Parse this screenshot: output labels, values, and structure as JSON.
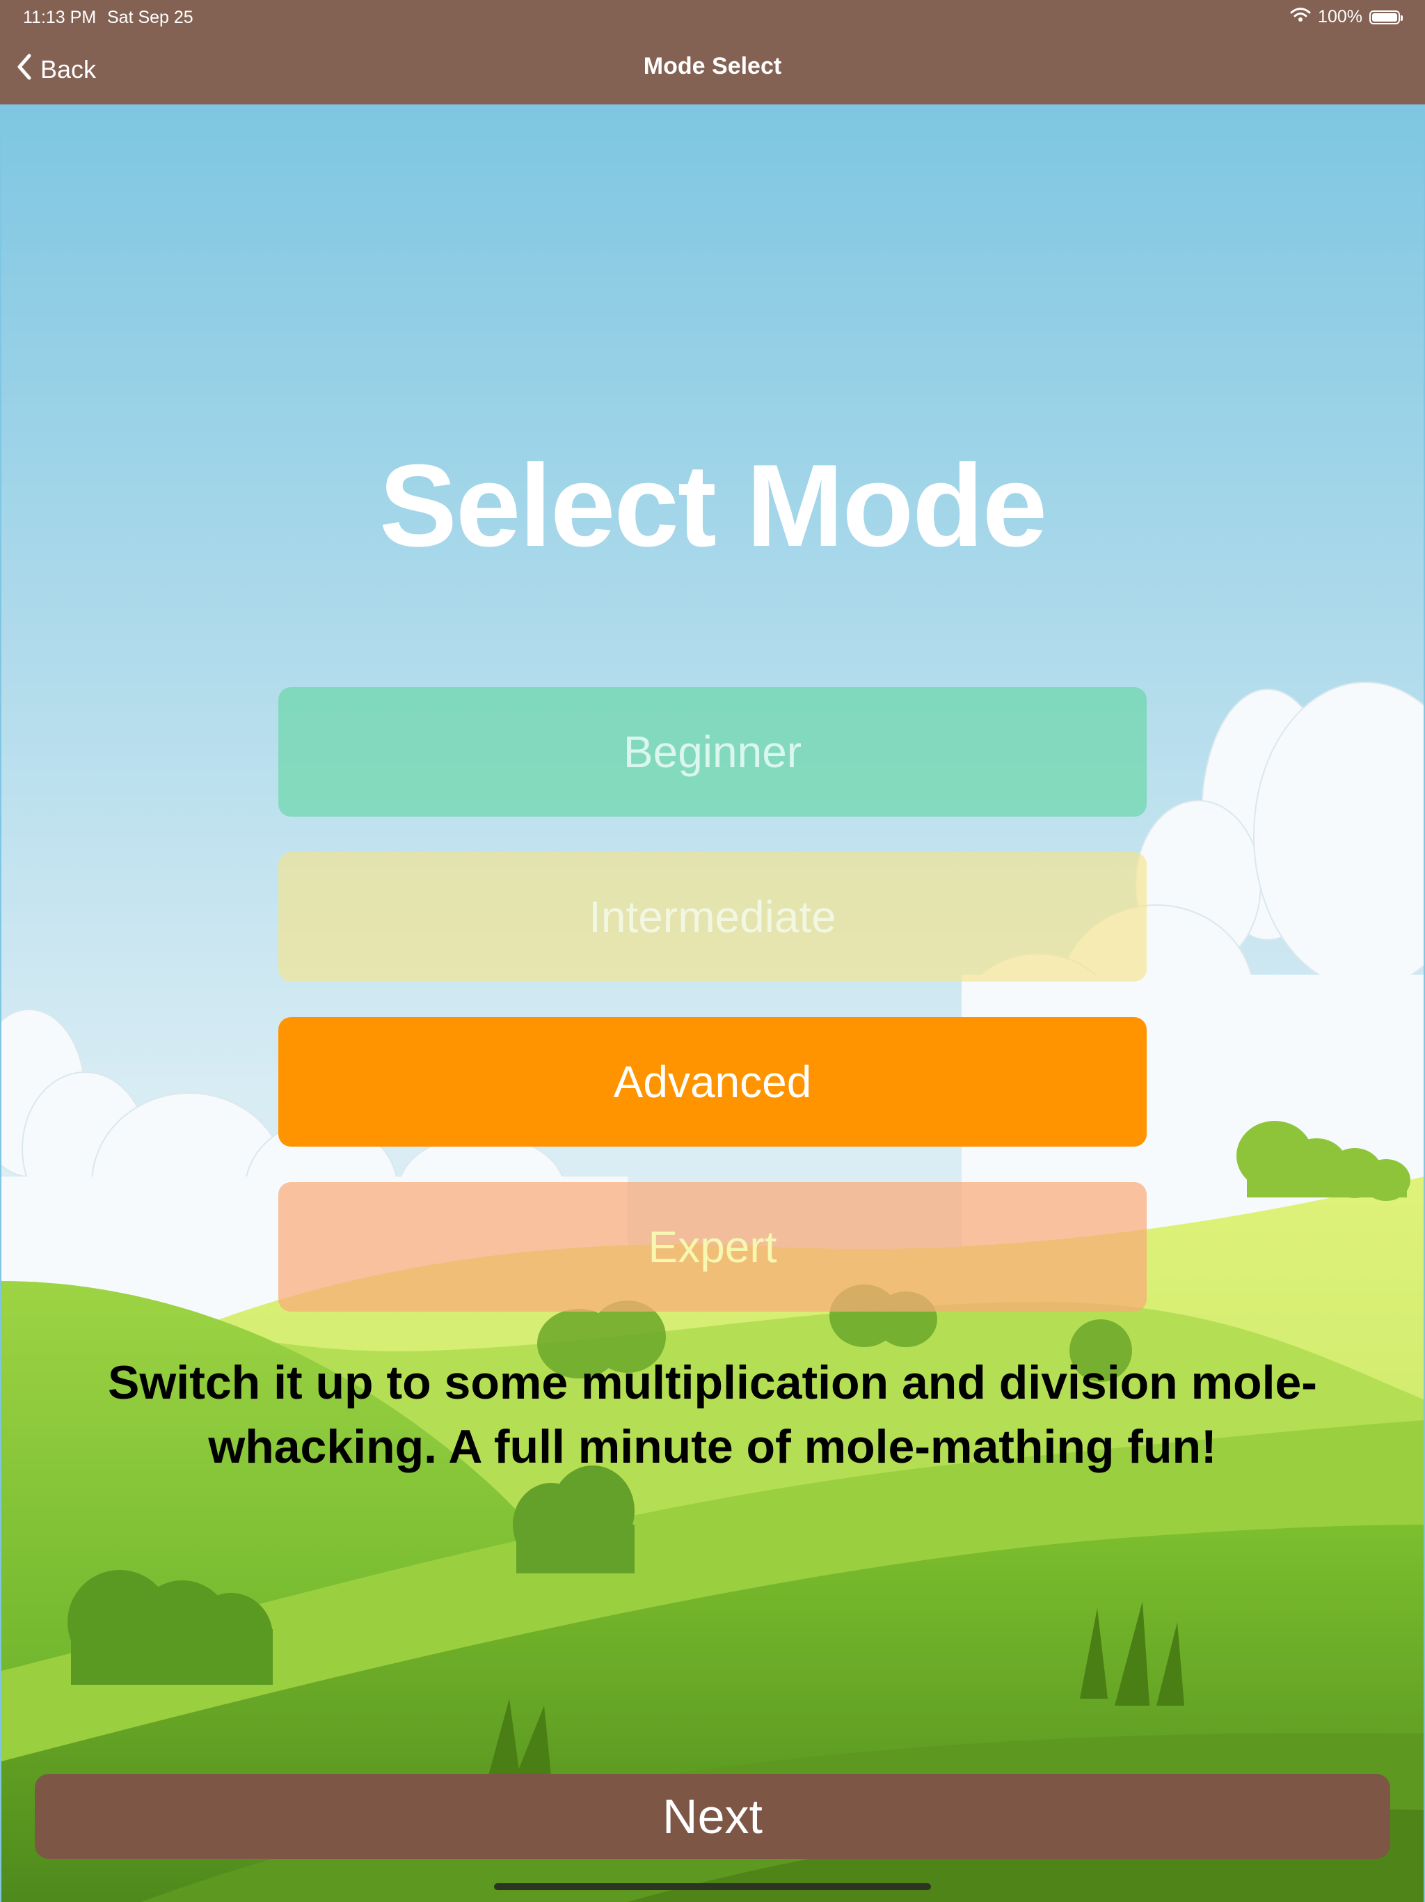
{
  "status_bar": {
    "time": "11:13 PM",
    "date": "Sat Sep 25",
    "battery_text": "100%",
    "battery_level": 1.0,
    "icons": [
      "wifi-icon",
      "battery-icon"
    ]
  },
  "nav": {
    "back_label": "Back",
    "back_icon": "chevron-left-icon",
    "title": "Mode Select"
  },
  "main": {
    "title": "Select Mode",
    "modes": [
      {
        "label": "Beginner",
        "selected": false,
        "color": "#6ed7aa"
      },
      {
        "label": "Intermediate",
        "selected": false,
        "color": "#f5e48c"
      },
      {
        "label": "Advanced",
        "selected": true,
        "color": "#ff9400"
      },
      {
        "label": "Expert",
        "selected": false,
        "color": "#faaa78"
      }
    ],
    "description": "Switch it up to some multiplication and division mole-whacking. A full minute of mole-mathing fun!",
    "next_label": "Next"
  },
  "colors": {
    "bar_brown": "#836253",
    "next_brown": "#7d5646",
    "sky": "#7fc6e2",
    "grass": "#8cc63e"
  }
}
